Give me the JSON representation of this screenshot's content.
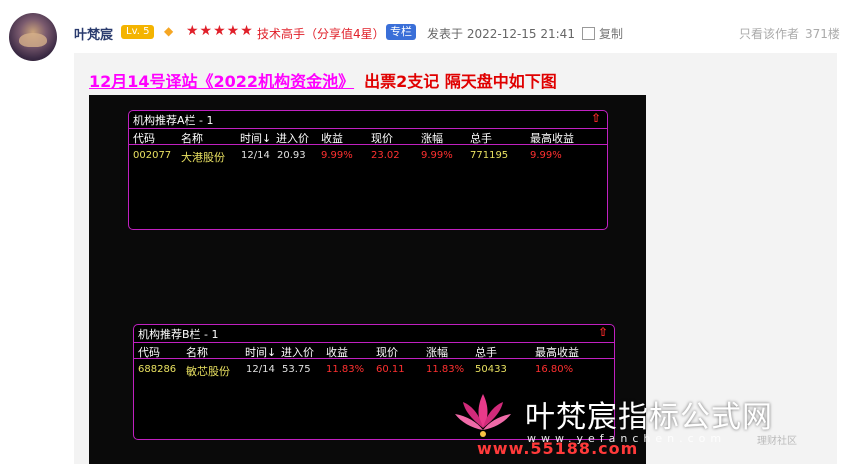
{
  "post": {
    "username": "叶梵宸",
    "level": "Lv. 5",
    "stars": "★★★★★",
    "tech_title": "技术高手（分享值4星）",
    "column_badge": "专栏",
    "posted": "发表于 2022-12-15 21:41",
    "copy_label": "复制",
    "only_author": "只看该作者",
    "floor": "371楼",
    "headline_link": "12月14号译站《2022机构资金池》",
    "headline_rest": "出票2支记  隔天盘中如下图"
  },
  "panels": [
    {
      "title": "机构推荐A栏 - 1",
      "headers": [
        "代码",
        "名称",
        "时间↓",
        "进入价",
        "收益",
        "现价",
        "涨幅",
        "总手",
        "最高收益"
      ],
      "row": [
        "002077",
        "大港股份",
        "12/14",
        "20.93",
        "9.99%",
        "23.02",
        "9.99%",
        "771195",
        "9.99%"
      ]
    },
    {
      "title": "机构推荐B栏 - 1",
      "headers": [
        "代码",
        "名称",
        "时间↓",
        "进入价",
        "收益",
        "现价",
        "涨幅",
        "总手",
        "最高收益"
      ],
      "row": [
        "688286",
        "敏芯股份",
        "12/14",
        "53.75",
        "11.83%",
        "60.11",
        "11.83%",
        "50433",
        "16.80%"
      ]
    }
  ],
  "watermark": {
    "title": "叶梵宸指标公式网",
    "url": "www.yefanchen.com",
    "site": "www.55188.com",
    "sub": "理财社区"
  },
  "icons": {
    "diamond": "diamond-icon",
    "copy": "copy-icon",
    "arrow": "red-up-arrow-icon"
  },
  "colors": {
    "link": "#ff00ff",
    "red": "#e00000",
    "panel_border": "#c020c0",
    "code_yellow": "#e8e060"
  }
}
